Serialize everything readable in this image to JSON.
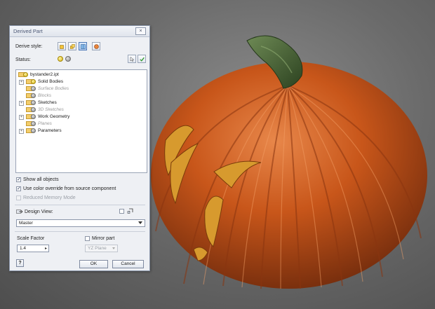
{
  "dialog": {
    "title": "Derived Part",
    "close_symbol": "×",
    "derive_style_label": "Derive style:",
    "status_label": "Status:",
    "tree": [
      {
        "label": "bystander2.ipt",
        "icon": "part-icon",
        "dim": false
      },
      {
        "label": "Solid Bodies",
        "icon": "yellow-status-icon",
        "dim": false
      },
      {
        "label": "Surface Bodies",
        "icon": "gray-status-icon",
        "dim": true
      },
      {
        "label": "Blocks",
        "icon": "gray-status-icon",
        "dim": true
      },
      {
        "label": "Sketches",
        "icon": "gray-status-icon",
        "dim": false
      },
      {
        "label": "3D Sketches",
        "icon": "gray-status-icon",
        "dim": true
      },
      {
        "label": "Work Geometry",
        "icon": "gray-status-icon",
        "dim": false
      },
      {
        "label": "Planes",
        "icon": "gray-status-icon",
        "dim": true
      },
      {
        "label": "Parameters",
        "icon": "gray-status-icon",
        "dim": false
      }
    ],
    "show_all_objects": {
      "label": "Show all objects",
      "checked": true
    },
    "use_color_override": {
      "label": "Use color override from source component",
      "checked": true
    },
    "reduced_memory_mode": {
      "label": "Reduced Memory Mode",
      "checked": false,
      "enabled": false
    },
    "design_view_label": "Design View:",
    "design_view_value": "Master",
    "scale_factor_label": "Scale Factor",
    "scale_factor_value": "1.4",
    "mirror_part": {
      "label": "Mirror part",
      "checked": false
    },
    "mirror_plane_value": "YZ Plane",
    "ok_label": "OK",
    "cancel_label": "Cancel",
    "help_symbol": "?"
  },
  "colors": {
    "pumpkin": "#c8561a",
    "stem": "#3f5a2c",
    "cutout": "#d79a2e",
    "viewport_bg": "#6a6a6a"
  }
}
